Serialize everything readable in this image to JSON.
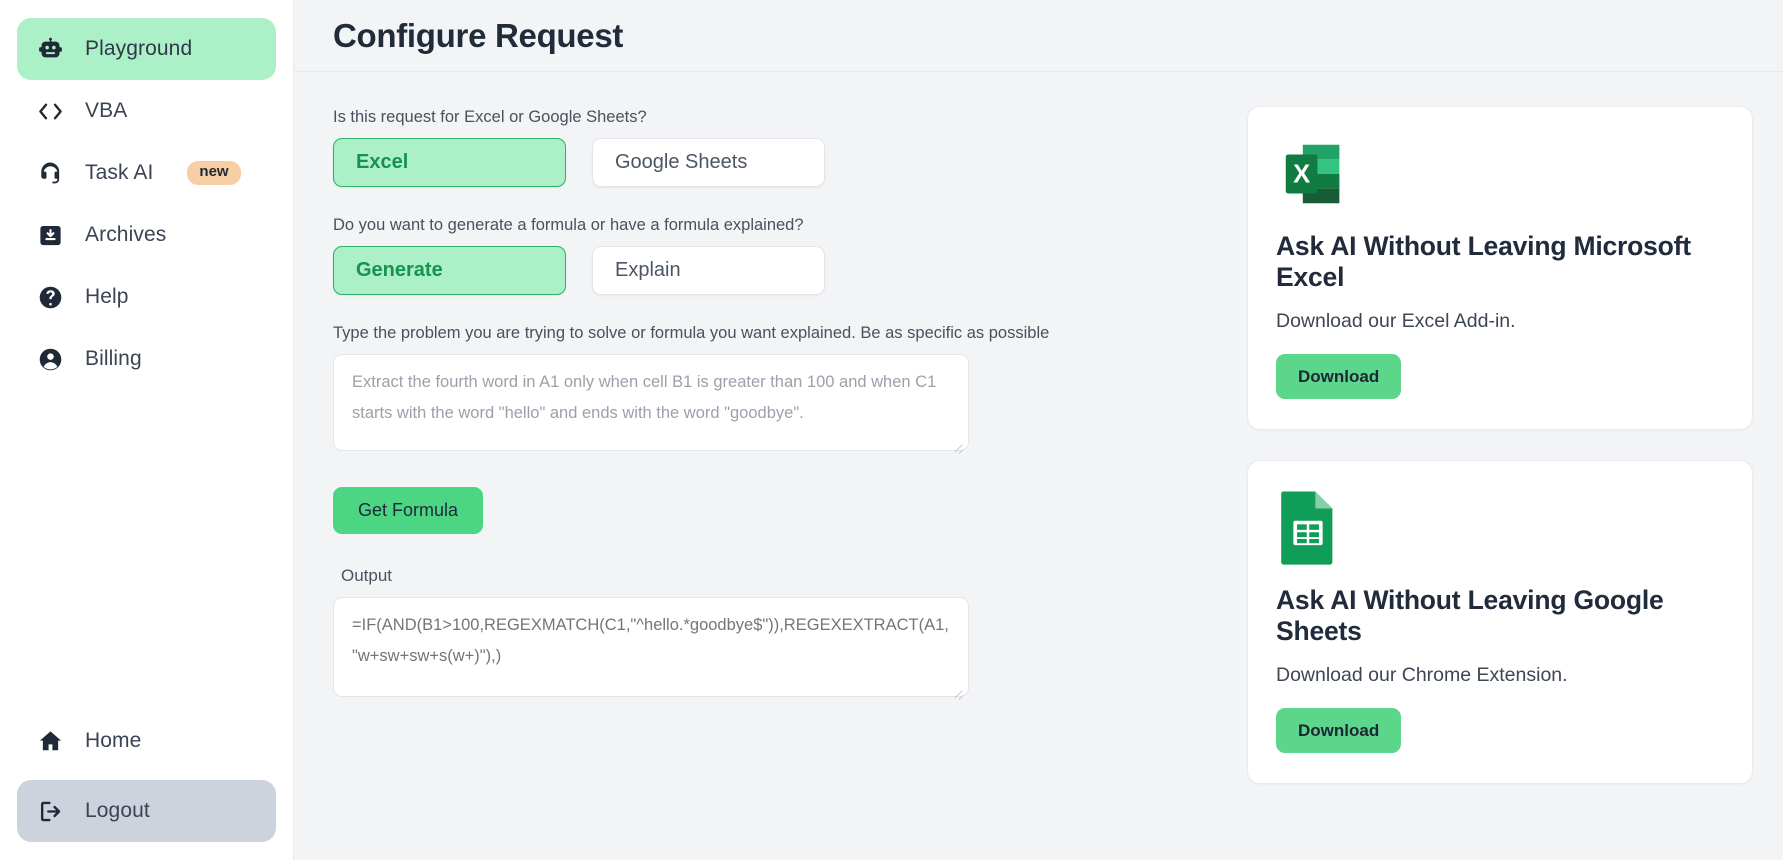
{
  "sidebar": {
    "items": [
      {
        "label": "Playground",
        "icon": "robot-icon",
        "state": "active"
      },
      {
        "label": "VBA",
        "icon": "code-brackets-icon",
        "state": "default"
      },
      {
        "label": "Task AI",
        "icon": "headset-icon",
        "state": "default",
        "badge": "new"
      },
      {
        "label": "Archives",
        "icon": "archive-download-icon",
        "state": "default"
      },
      {
        "label": "Help",
        "icon": "question-circle-icon",
        "state": "default"
      },
      {
        "label": "Billing",
        "icon": "user-circle-icon",
        "state": "default"
      }
    ],
    "bottom_items": [
      {
        "label": "Home",
        "icon": "home-icon",
        "state": "default"
      },
      {
        "label": "Logout",
        "icon": "logout-icon",
        "state": "highlighted"
      }
    ]
  },
  "header": {
    "title": "Configure Request"
  },
  "form": {
    "platform_question": "Is this request for Excel or Google Sheets?",
    "platform_options": [
      {
        "label": "Excel",
        "selected": true
      },
      {
        "label": "Google Sheets",
        "selected": false
      }
    ],
    "mode_question": "Do you want to generate a formula or have a formula explained?",
    "mode_options": [
      {
        "label": "Generate",
        "selected": true
      },
      {
        "label": "Explain",
        "selected": false
      }
    ],
    "prompt_label": "Type the problem you are trying to solve or formula you want explained. Be as specific as possible",
    "prompt_placeholder": "Extract the fourth word in A1 only when cell B1 is greater than 100 and when C1 starts with the word \"hello\" and ends with the word \"goodbye\".",
    "prompt_value": "",
    "submit_label": "Get Formula",
    "output_label": "Output",
    "output_value": "=IF(AND(B1>100,REGEXMATCH(C1,\"^hello.*goodbye$\")),REGEXEXTRACT(A1,\"w+sw+sw+s(w+)\"),)"
  },
  "promos": [
    {
      "icon": "microsoft-excel-icon",
      "title": "Ask AI Without Leaving Microsoft Excel",
      "subtitle": "Download our Excel Add-in.",
      "button": "Download"
    },
    {
      "icon": "google-sheets-icon",
      "title": "Ask AI Without Leaving Google Sheets",
      "subtitle": "Download our Chrome Extension.",
      "button": "Download"
    }
  ],
  "colors": {
    "accent_green": "#4cd583",
    "selected_fill": "#abf0c6",
    "selected_text": "#17924f",
    "badge_peach": "#f8cfa5",
    "logout_bg": "#cdd3dd",
    "page_bg": "#f3f4f6"
  }
}
